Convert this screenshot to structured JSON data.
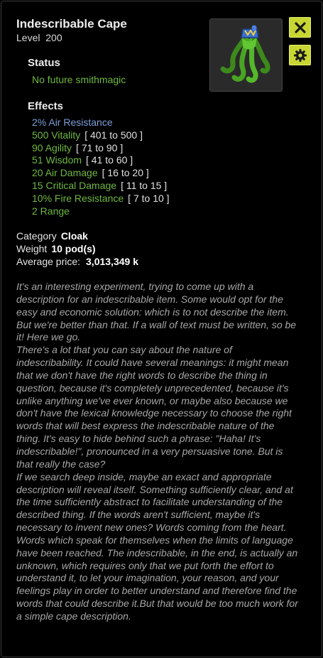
{
  "item": {
    "name": "Indescribable Cape",
    "level_label": "Level",
    "level": "200"
  },
  "status": {
    "heading": "Status",
    "text": "No future smithmagic"
  },
  "effects": {
    "heading": "Effects",
    "lines": [
      {
        "text": "2% Air Resistance",
        "range": "",
        "color": "blue"
      },
      {
        "text": "500 Vitality",
        "range": "[ 401 to 500 ]",
        "color": "green"
      },
      {
        "text": "90 Agility",
        "range": "[ 71 to 90 ]",
        "color": "green"
      },
      {
        "text": "51 Wisdom",
        "range": "[ 41 to 60 ]",
        "color": "green"
      },
      {
        "text": "20 Air Damage",
        "range": "[ 16 to 20 ]",
        "color": "green"
      },
      {
        "text": "15 Critical Damage",
        "range": "[ 11 to 15 ]",
        "color": "green"
      },
      {
        "text": "10% Fire Resistance",
        "range": "[ 7 to 10 ]",
        "color": "green"
      },
      {
        "text": "2 Range",
        "range": "",
        "color": "green"
      }
    ]
  },
  "info": {
    "category_label": "Category",
    "category": "Cloak",
    "weight_label": "Weight",
    "weight": "10 pod(s)",
    "price_label": "Average price:",
    "price": "3,013,349 k"
  },
  "description": [
    "It's an interesting experiment, trying to come up with a description for an indescribable item. Some would opt for the easy and economic solution: which is to not describe the item. But we're better than that. If a wall of text must be written, so be it! Here we go.",
    "There's a lot that you can say about the nature of indescribability. It could have several meanings: it might mean that we don't have the right words to describe the thing in question, because it's completely unprecedented, because it's unlike anything we've ever known, or maybe also because we don't have the lexical knowledge necessary to choose the right words that will best express the indescribable nature of the thing. It's easy to hide behind such a phrase: \"Haha! It's indescribable!\", pronounced in a very persuasive tone. But is that really the case?",
    "If we search deep inside, maybe an exact and appropriate description will reveal itself. Something sufficiently clear, and at the time sufficiently abstract to facilitate understanding of the described thing. If the words aren't sufficient, maybe it's necessary to invent new ones? Words coming from the heart. Words which speak for themselves when the limits of language have been reached. The indescribable, in the end, is actually an unknown, which requires only that we put forth the effort to understand it, to let your imagination, your reason, and your feelings play in order to better understand and therefore find the words that could describe it.But that would be too much work for a simple cape description."
  ],
  "icons": {
    "close": "close-icon",
    "settings": "gear-icon",
    "item": "cape-icon"
  },
  "colors": {
    "green": "#6fb840",
    "blue": "#7a9fd8",
    "button": "#c8d633"
  }
}
